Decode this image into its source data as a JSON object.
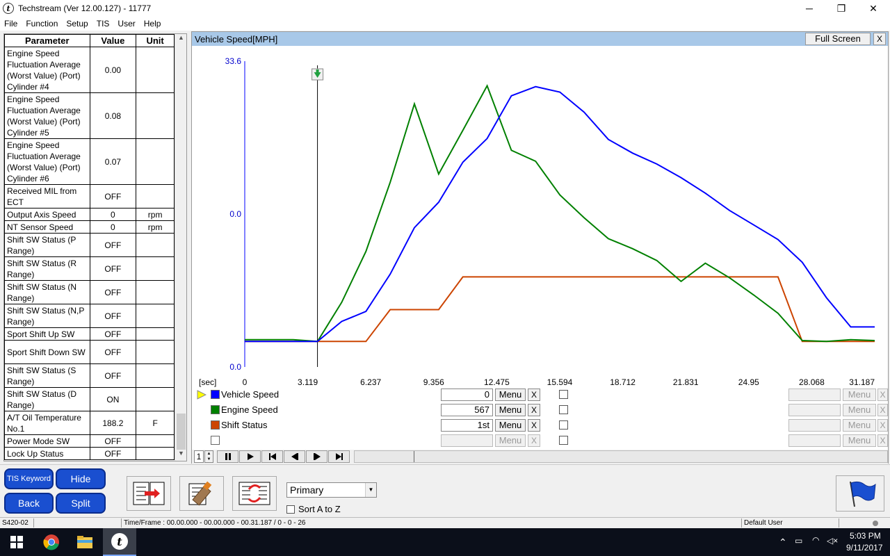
{
  "window": {
    "title": "Techstream (Ver 12.00.127) - 11777",
    "icon_letter": "t",
    "minimize": "─",
    "maximize": "❐",
    "close": "✕"
  },
  "menu": [
    "File",
    "Function",
    "Setup",
    "TIS",
    "User",
    "Help"
  ],
  "params": {
    "headers": {
      "parameter": "Parameter",
      "value": "Value",
      "unit": "Unit"
    },
    "rows": [
      {
        "name": "Engine Speed Fluctuation Average (Worst Value) (Port) Cylinder #4",
        "value": "0.00",
        "unit": ""
      },
      {
        "name": "Engine Speed Fluctuation Average (Worst Value) (Port) Cylinder #5",
        "value": "0.08",
        "unit": ""
      },
      {
        "name": "Engine Speed Fluctuation Average (Worst Value) (Port) Cylinder #6",
        "value": "0.07",
        "unit": ""
      },
      {
        "name": "Received MIL from ECT",
        "value": "OFF",
        "unit": ""
      },
      {
        "name": "Output Axis Speed",
        "value": "0",
        "unit": "rpm"
      },
      {
        "name": "NT Sensor Speed",
        "value": "0",
        "unit": "rpm"
      },
      {
        "name": "Shift SW Status (P Range)",
        "value": "OFF",
        "unit": ""
      },
      {
        "name": "Shift SW Status (R Range)",
        "value": "OFF",
        "unit": ""
      },
      {
        "name": "Shift SW Status (N Range)",
        "value": "OFF",
        "unit": ""
      },
      {
        "name": "Shift SW Status (N,P Range)",
        "value": "OFF",
        "unit": ""
      },
      {
        "name": "Sport Shift Up SW",
        "value": "OFF",
        "unit": ""
      },
      {
        "name": "Sport Shift Down SW",
        "value": "OFF",
        "unit": ""
      },
      {
        "name": "Shift SW Status (S Range)",
        "value": "OFF",
        "unit": ""
      },
      {
        "name": "Shift SW Status (D Range)",
        "value": "ON",
        "unit": ""
      },
      {
        "name": "A/T Oil Temperature No.1",
        "value": "188.2",
        "unit": "F"
      },
      {
        "name": "Power Mode SW",
        "value": "OFF",
        "unit": ""
      },
      {
        "name": "Lock Up Status",
        "value": "OFF",
        "unit": ""
      }
    ]
  },
  "graph": {
    "title": "Vehicle Speed[MPH]",
    "full_screen_label": "Full Screen",
    "close_label": "X",
    "x_unit_label": "[sec]",
    "legend": [
      {
        "name": "Vehicle Speed",
        "color": "#0000ff",
        "value": "0",
        "menu": "Menu",
        "x": "X",
        "selected": true
      },
      {
        "name": "Engine Speed",
        "color": "#008000",
        "value": "567",
        "menu": "Menu",
        "x": "X",
        "selected": false
      },
      {
        "name": "Shift Status",
        "color": "#cc4400",
        "value": "1st",
        "menu": "Menu",
        "x": "X",
        "selected": false
      },
      {
        "name": "",
        "color": "",
        "value": "",
        "menu": "Menu",
        "x": "X",
        "selected": false
      }
    ],
    "right_menu_label": "Menu",
    "right_x_label": "X",
    "page_number": "1"
  },
  "chart_data": {
    "type": "line",
    "title": "Vehicle Speed[MPH]",
    "xlabel": "[sec]",
    "ylabel": "",
    "xlim": [
      0,
      31.187
    ],
    "ylim": [
      0,
      33.6
    ],
    "y_ticks": [
      "33.6",
      "0.0",
      "0.0"
    ],
    "x_ticks": [
      "0",
      "3.119",
      "6.237",
      "9.356",
      "12.475",
      "15.594",
      "18.712",
      "21.831",
      "24.95",
      "28.068",
      "31.187"
    ],
    "cursor_x": 3.6,
    "x": [
      0,
      1.2,
      2.4,
      3.6,
      4.8,
      6.0,
      7.2,
      8.4,
      9.6,
      10.8,
      12.0,
      13.2,
      14.4,
      15.6,
      16.8,
      18.0,
      19.2,
      20.4,
      21.6,
      22.8,
      24.0,
      25.2,
      26.4,
      27.6,
      28.8,
      30.0,
      31.187
    ],
    "series": [
      {
        "name": "Vehicle Speed",
        "color": "#0000ff",
        "values": [
          2.8,
          2.8,
          2.8,
          2.8,
          5.0,
          6.1,
          10.2,
          15.3,
          18.1,
          22.5,
          25.1,
          29.8,
          30.8,
          30.2,
          28.0,
          25.0,
          23.5,
          22.3,
          20.8,
          19.1,
          17.2,
          15.6,
          14.0,
          11.5,
          7.6,
          4.4,
          4.4
        ]
      },
      {
        "name": "Engine Speed",
        "color": "#008000",
        "values": [
          3.0,
          3.0,
          3.0,
          2.8,
          7.1,
          12.7,
          20.3,
          28.9,
          21.2,
          26.0,
          30.9,
          23.8,
          22.6,
          18.9,
          16.4,
          14.1,
          13.0,
          11.7,
          9.4,
          11.4,
          9.8,
          7.9,
          5.9,
          2.9,
          2.8,
          3.0,
          2.9
        ]
      },
      {
        "name": "Shift Status",
        "color": "#cc4400",
        "values": [
          2.8,
          2.8,
          2.8,
          2.8,
          2.8,
          2.8,
          6.3,
          6.3,
          6.3,
          9.9,
          9.9,
          9.9,
          9.9,
          9.9,
          9.9,
          9.9,
          9.9,
          9.9,
          9.9,
          9.9,
          9.9,
          9.9,
          9.9,
          2.8,
          2.8,
          2.8,
          2.8
        ]
      }
    ]
  },
  "bottom": {
    "tis_keyword": "TIS Keyword",
    "hide": "Hide",
    "back": "Back",
    "split": "Split",
    "select_value": "Primary",
    "sort_label": "Sort A to Z"
  },
  "status": {
    "left": "S420-02",
    "time_frame": "Time/Frame : 00.00.000 - 00.00.000 - 00.31.187 / 0 - 0 - 26",
    "user": "Default User"
  },
  "taskbar": {
    "time": "5:03 PM",
    "date": "9/11/2017"
  }
}
